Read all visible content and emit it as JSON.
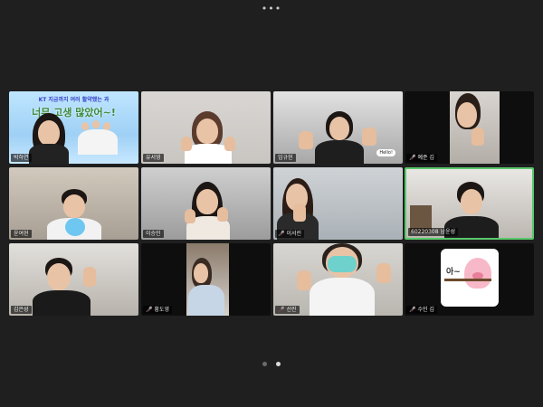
{
  "app": {
    "menu_dots": "•••"
  },
  "participants": [
    {
      "name": "박하연",
      "muted": false
    },
    {
      "name": "유서영",
      "muted": false
    },
    {
      "name": "임규현",
      "muted": false
    },
    {
      "name": "예준 김",
      "muted": true
    },
    {
      "name": "윤여현",
      "muted": false
    },
    {
      "name": "이승민",
      "muted": false
    },
    {
      "name": "이서린",
      "muted": true
    },
    {
      "name": "60220308 남윤성",
      "muted": false,
      "active_speaker": true
    },
    {
      "name": "김은성",
      "muted": false
    },
    {
      "name": "황도영",
      "muted": true
    },
    {
      "name": "선린",
      "muted": true
    },
    {
      "name": "수민 김",
      "muted": true
    }
  ],
  "banner": {
    "line1": "KT 지금까지 여러 활약했는 과",
    "line2": "너무 고생 많았어~!"
  },
  "speech_bubble": "Hello!",
  "sticker": {
    "text": "아~"
  },
  "pagination": {
    "total": 2,
    "current": 2
  },
  "colors": {
    "background": "#1f1f1f",
    "active_speaker_border": "#59c86b",
    "muted_icon": "#e3443b"
  }
}
